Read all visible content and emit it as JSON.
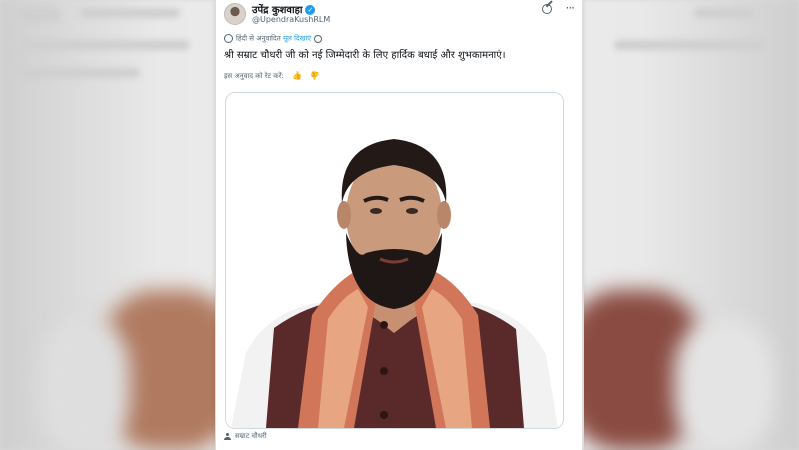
{
  "post": {
    "author_name": "उपेंद्र कुशवाहा",
    "author_handle": "@UpendraKushRLM",
    "translated_note": "हिंदी से अनुवादित",
    "show_original": "मूल दिखाएं",
    "text": "श्री सम्राट चौधरी जी को नई जिम्मेदारी के लिए हार्दिक बधाई और शुभकामनाएं।",
    "rate_translation": "इस अनुवाद को रेट करें:",
    "media_caption": "सम्राट चौधरी"
  },
  "icons": {
    "verified": "verified-badge-icon",
    "grok": "grok-icon",
    "more": "more-icon",
    "globe": "globe-icon",
    "settings": "gear-icon",
    "thumbs_up": "thumbs-up-icon",
    "thumbs_down": "thumbs-down-icon",
    "tagged_user": "user-icon"
  },
  "colors": {
    "accent": "#1d9bf0",
    "text_primary": "#0f1419",
    "text_secondary": "#536471",
    "vest": "#5a2a2a",
    "stole": "#d2765a"
  }
}
